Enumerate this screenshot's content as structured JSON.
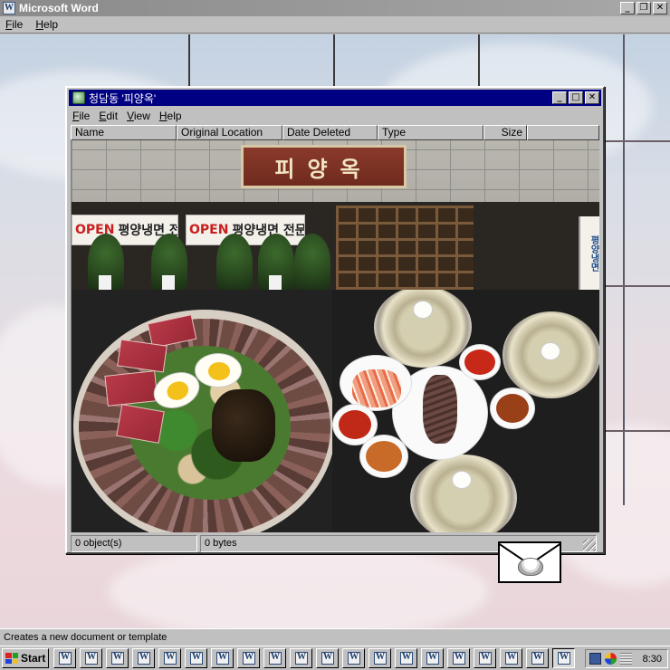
{
  "app": {
    "title": "Microsoft Word",
    "menu": [
      "File",
      "Help"
    ],
    "status_text": "Creates a new document or template"
  },
  "explorer": {
    "title": "청담동 '피양옥'",
    "menu": [
      "File",
      "Edit",
      "View",
      "Help"
    ],
    "columns": [
      "Name",
      "Original Location",
      "Date Deleted",
      "Type",
      "Size"
    ],
    "status": {
      "objects": "0 object(s)",
      "bytes": "0 bytes"
    },
    "photo": {
      "sign_text": "피양옥",
      "banner_left": {
        "open": "OPEN",
        "text": "평양냉면 전"
      },
      "banner_right": {
        "open": "OPEN",
        "text": "평양냉면 전문점"
      },
      "side_sign": "평양냉면"
    }
  },
  "taskbar": {
    "start_label": "Start",
    "clock": "8:30",
    "window_buttons": 20,
    "active_button_index": 19
  },
  "colors": {
    "titlebar_active": "#000082",
    "face": "#c0c0c0"
  },
  "icons": [
    "word-icon",
    "recycle-bin-icon",
    "minimize-icon",
    "maximize-icon",
    "close-icon",
    "restore-icon",
    "mail-envelope-icon",
    "windows-logo-icon"
  ]
}
